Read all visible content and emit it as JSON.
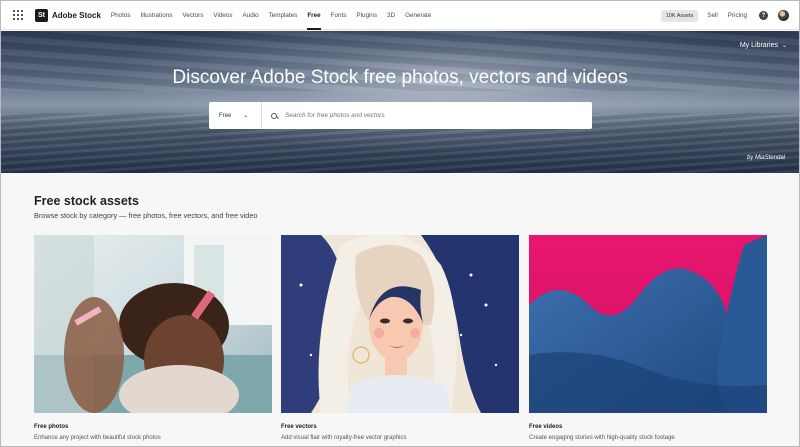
{
  "nav": {
    "brand": "Adobe Stock",
    "logo_text": "St",
    "links": [
      "Photos",
      "Illustrations",
      "Vectors",
      "Videos",
      "Audio",
      "Templates",
      "Free",
      "Fonts",
      "Plugins",
      "3D",
      "Generate"
    ],
    "active": "Free",
    "assets_label": "10K Assets",
    "sell": "Sell",
    "pricing": "Pricing",
    "help_icon": "?"
  },
  "hero": {
    "my_libraries": "My Libraries",
    "title": "Discover Adobe Stock free photos, vectors and videos",
    "search_select": "Free",
    "search_placeholder": "Search for free photos and vectors",
    "credit": "by MiaStendal"
  },
  "section": {
    "title": "Free stock assets",
    "subtitle": "Browse stock by category — free photos, free vectors, and free video"
  },
  "cards": [
    {
      "title": "Free photos",
      "desc": "Enhance any project with beautiful stock photos"
    },
    {
      "title": "Free vectors",
      "desc": "Add visual flair with royalty-free vector graphics"
    },
    {
      "title": "Free videos",
      "desc": "Create engaging stories with high-quality stock footage"
    }
  ],
  "colors": {
    "accent": "#1a1a1a",
    "video_pink": "#e8166f",
    "video_blue": "#2a5a96"
  }
}
